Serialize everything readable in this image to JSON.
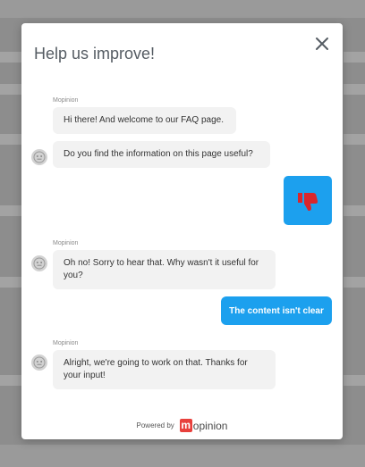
{
  "modal": {
    "title": "Help us improve!"
  },
  "messages": {
    "sender_name_1": "Mopinion",
    "greeting": "Hi there! And welcome to our FAQ page.",
    "question": "Do you find the information on this page useful?",
    "sender_name_2": "Mopinion",
    "followup": "Oh no! Sorry to hear that. Why wasn't it useful for you?",
    "user_reply": "The content isn't clear",
    "sender_name_3": "Mopinion",
    "closing": "Alright, we're going to work on that. Thanks for your input!"
  },
  "footer": {
    "powered_by": "Powered by",
    "brand_m": "m",
    "brand_rest": "opinion"
  },
  "icons": {
    "close": "close-icon",
    "avatar": "bot-face-icon",
    "thumbs": "thumbs-down-icon"
  },
  "colors": {
    "accent_blue": "#1ca0ee",
    "thumbs_red": "#d9262c",
    "brand_red": "#e8403c",
    "bubble_gray": "#f2f2f2"
  }
}
